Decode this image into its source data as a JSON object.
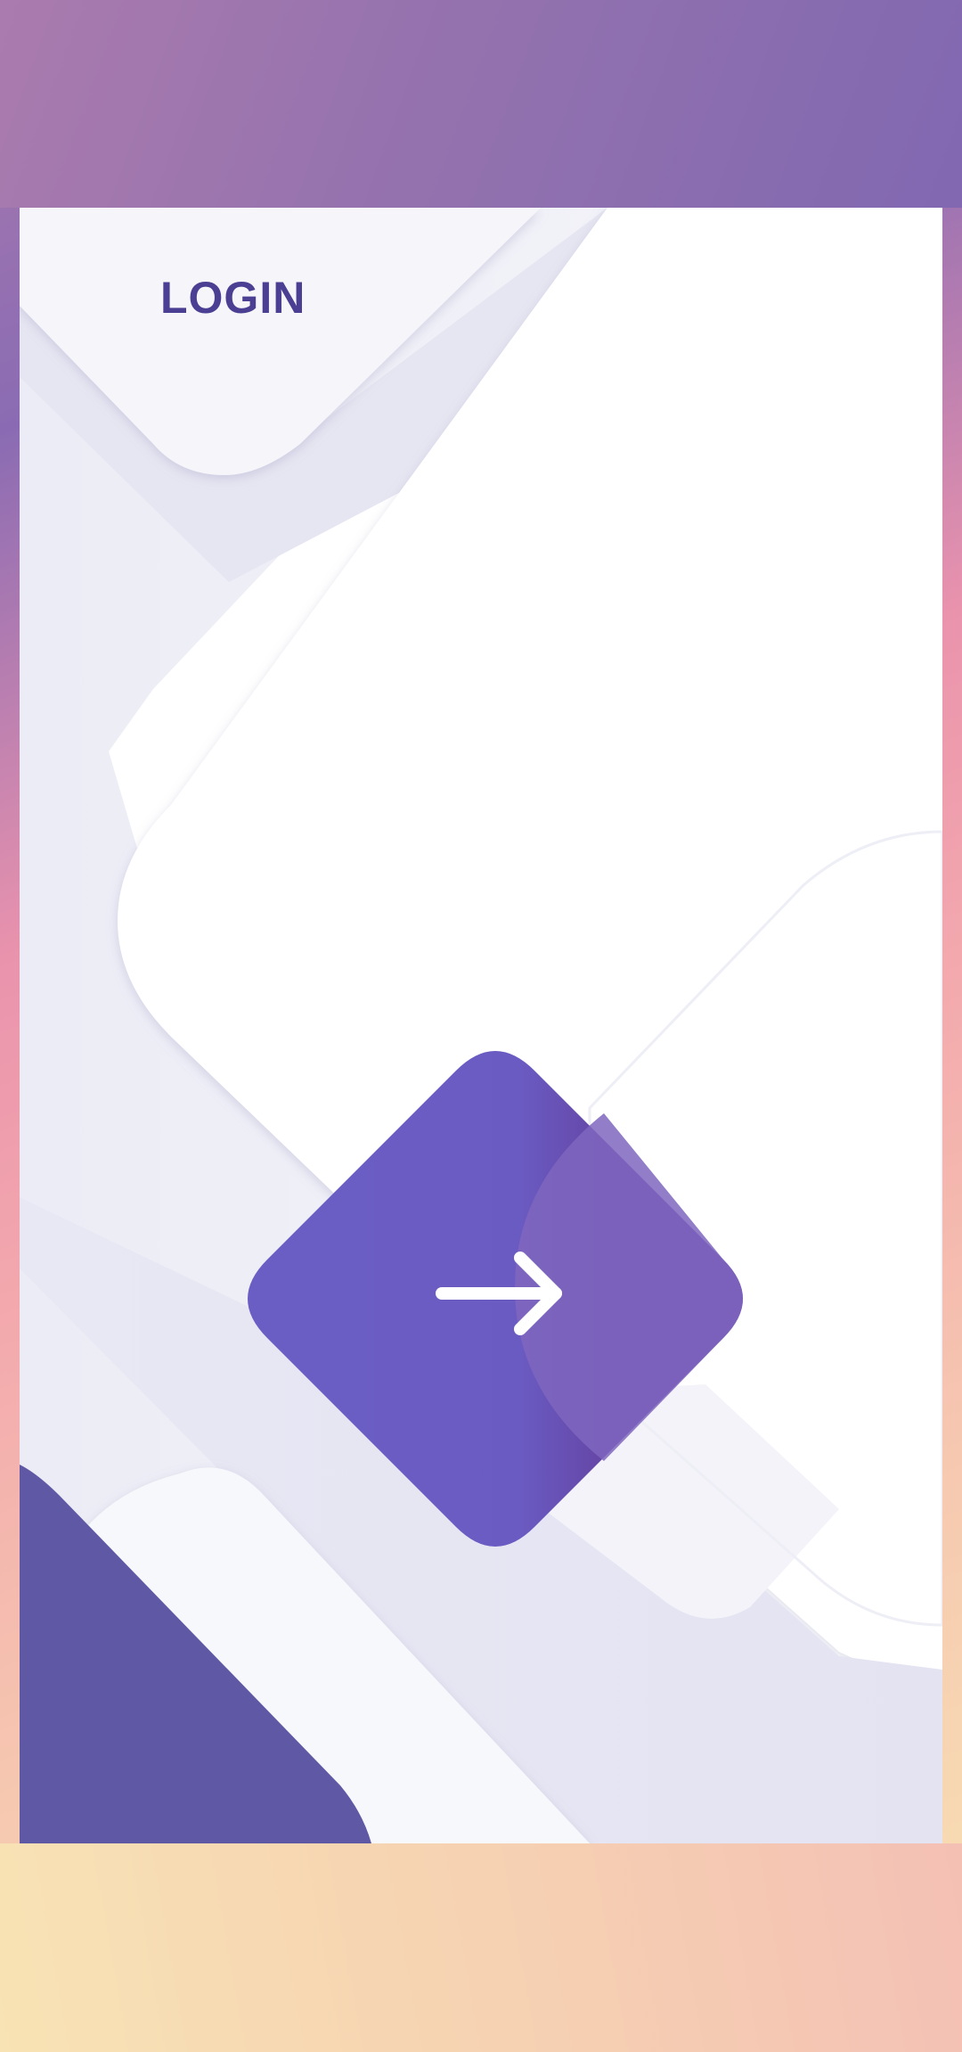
{
  "header": {
    "title": "LOGIN"
  },
  "actions": {
    "next_icon": "arrow-right-icon"
  },
  "colors": {
    "accent": "#6a5bc2",
    "accent_dark": "#6548a8",
    "title": "#4a3f92",
    "panel_light": "#f4f4f9",
    "panel_mid": "#e6e6f3",
    "card_bg": "#ffffff",
    "dark_tile": "#5f58a4"
  }
}
